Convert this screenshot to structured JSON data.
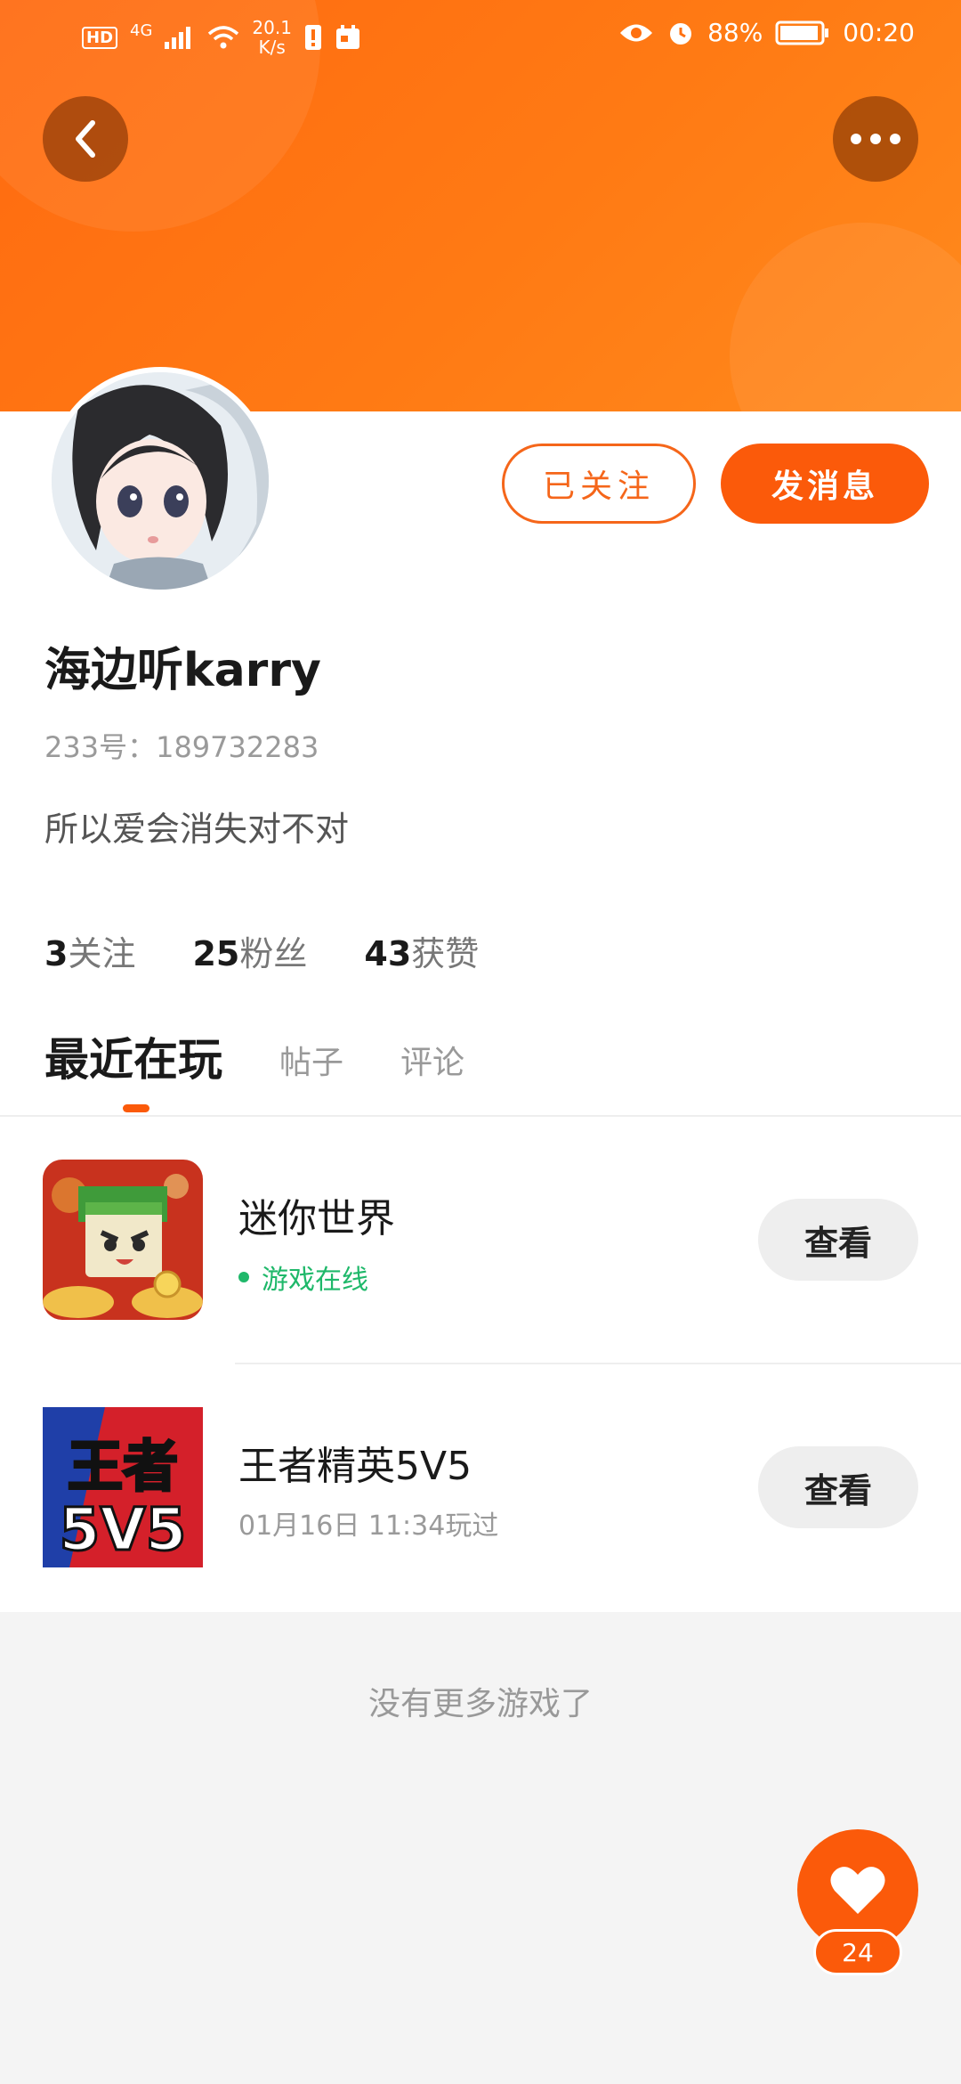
{
  "status_bar": {
    "network_badge": "HD",
    "network_type": "4G",
    "speed_value": "20.1",
    "speed_unit": "K/s",
    "battery": "88%",
    "time": "00:20"
  },
  "header": {
    "back_icon": "chevron-left-icon",
    "more_icon": "more-horizontal-icon"
  },
  "profile": {
    "username": "海边听karry",
    "uid": "233号：189732283",
    "bio": "所以爱会消失对不对",
    "follow_button": "已关注",
    "message_button": "发消息",
    "stats": [
      {
        "value": "3",
        "label": "关注"
      },
      {
        "value": "25",
        "label": "粉丝"
      },
      {
        "value": "43",
        "label": "获赞"
      }
    ]
  },
  "tabs": [
    {
      "label": "最近在玩",
      "active": true
    },
    {
      "label": "帖子",
      "active": false
    },
    {
      "label": "评论",
      "active": false
    }
  ],
  "games": [
    {
      "name": "迷你世界",
      "status": "游戏在线",
      "status_color": "#1fb86a",
      "button": "查看"
    },
    {
      "name": "王者精英5V5",
      "status": "01月16日 11:34玩过",
      "status_color": "#9a9a9a",
      "button": "查看",
      "icon_text_1": "王者",
      "icon_text_2": "5V5"
    }
  ],
  "footer": {
    "no_more": "没有更多游戏了"
  },
  "like_fab": {
    "icon": "heart-icon",
    "count": "24"
  },
  "colors": {
    "accent": "#fb5a0a",
    "header_gradient_start": "#ff6a10",
    "online_green": "#1fb86a"
  }
}
